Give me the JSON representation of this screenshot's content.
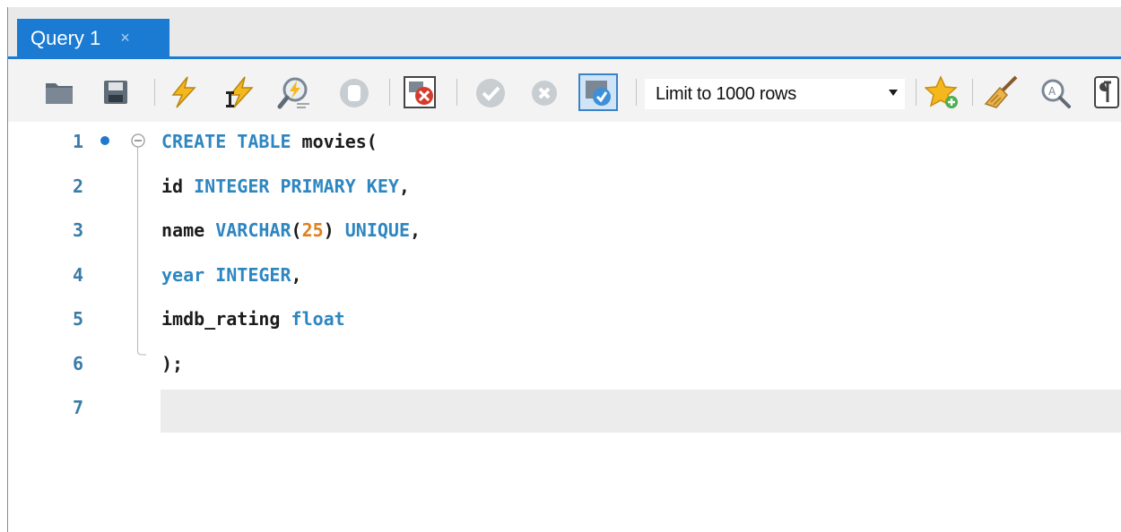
{
  "tabs": [
    {
      "label": "Query 1",
      "close_glyph": "×",
      "active": true
    }
  ],
  "toolbar": {
    "icons": [
      "open-folder-icon",
      "save-icon",
      "execute-icon",
      "execute-current-icon",
      "explain-icon",
      "stop-icon",
      "toggle-error-stop-icon",
      "commit-icon",
      "rollback-icon",
      "autocommit-icon",
      "add-snippet-icon",
      "beautify-icon",
      "find-icon",
      "invisibles-icon"
    ],
    "limit_select": {
      "value": "Limit to 1000 rows"
    }
  },
  "editor": {
    "lines": [
      {
        "number": "1",
        "tokens": [
          {
            "t": "CREATE TABLE",
            "c": "kw"
          },
          {
            "t": " movies(",
            "c": ""
          }
        ],
        "breakpoint": true,
        "fold_start": true
      },
      {
        "number": "2",
        "tokens": [
          {
            "t": "id ",
            "c": ""
          },
          {
            "t": "INTEGER PRIMARY KEY",
            "c": "kw"
          },
          {
            "t": ",",
            "c": ""
          }
        ]
      },
      {
        "number": "3",
        "tokens": [
          {
            "t": "name ",
            "c": ""
          },
          {
            "t": "VARCHAR",
            "c": "kw"
          },
          {
            "t": "(",
            "c": ""
          },
          {
            "t": "25",
            "c": "num"
          },
          {
            "t": ") ",
            "c": ""
          },
          {
            "t": "UNIQUE",
            "c": "kw"
          },
          {
            "t": ",",
            "c": ""
          }
        ]
      },
      {
        "number": "4",
        "tokens": [
          {
            "t": "year",
            "c": "kw"
          },
          {
            "t": " ",
            "c": ""
          },
          {
            "t": "INTEGER",
            "c": "kw"
          },
          {
            "t": ",",
            "c": ""
          }
        ]
      },
      {
        "number": "5",
        "tokens": [
          {
            "t": "imdb_rating ",
            "c": ""
          },
          {
            "t": "float",
            "c": "kw"
          }
        ]
      },
      {
        "number": "6",
        "tokens": [
          {
            "t": ");",
            "c": ""
          }
        ],
        "fold_end": true
      },
      {
        "number": "7",
        "tokens": [],
        "current": true
      }
    ]
  },
  "colors": {
    "accent": "#1b7bd3",
    "keyword": "#2e86c1",
    "number": "#e0801c",
    "line_number": "#3a7ca8"
  }
}
